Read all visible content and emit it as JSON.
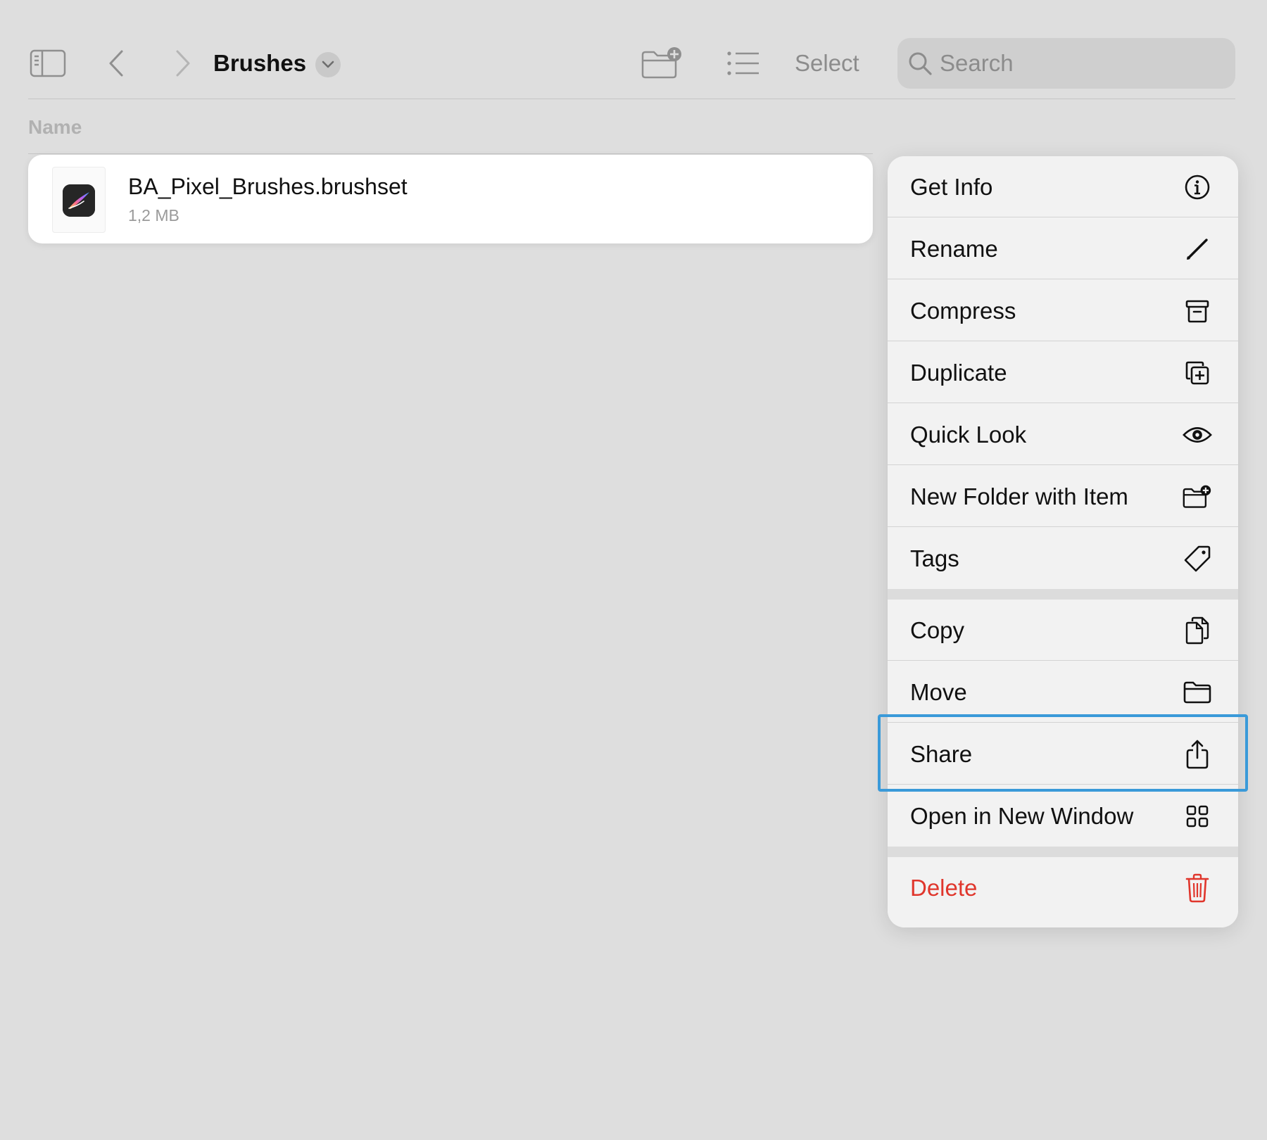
{
  "toolbar": {
    "title": "Brushes",
    "select_label": "Select",
    "search_placeholder": "Search",
    "icons": {
      "sidebar": "sidebar-icon",
      "back": "chevron-left-icon",
      "forward": "chevron-right-icon",
      "title_menu": "chevron-down-icon",
      "new_folder": "folder-plus-icon",
      "list_view": "list-icon",
      "search": "magnifier-icon"
    }
  },
  "list": {
    "column_header": "Name",
    "files": [
      {
        "name": "BA_Pixel_Brushes.brushset",
        "size": "1,2 MB",
        "icon": "procreate-app-icon"
      }
    ]
  },
  "context_menu": {
    "groups": [
      [
        {
          "label": "Get Info",
          "icon": "info-circle-icon"
        },
        {
          "label": "Rename",
          "icon": "pencil-icon"
        },
        {
          "label": "Compress",
          "icon": "archive-box-icon"
        },
        {
          "label": "Duplicate",
          "icon": "duplicate-plus-icon"
        },
        {
          "label": "Quick Look",
          "icon": "eye-icon"
        },
        {
          "label": "New Folder with Item",
          "icon": "folder-plus-icon"
        },
        {
          "label": "Tags",
          "icon": "tag-icon"
        }
      ],
      [
        {
          "label": "Copy",
          "icon": "copy-documents-icon"
        },
        {
          "label": "Move",
          "icon": "folder-icon"
        },
        {
          "label": "Share",
          "icon": "share-icon",
          "highlighted": true
        },
        {
          "label": "Open in New Window",
          "icon": "grid-windows-icon"
        }
      ],
      [
        {
          "label": "Delete",
          "icon": "trash-icon",
          "destructive": true
        }
      ]
    ]
  },
  "colors": {
    "background": "#dedede",
    "menu_background": "#f2f2f2",
    "destructive": "#e0362c",
    "highlight": "#3a9ad9",
    "secondary_text": "#8c8c8c"
  }
}
